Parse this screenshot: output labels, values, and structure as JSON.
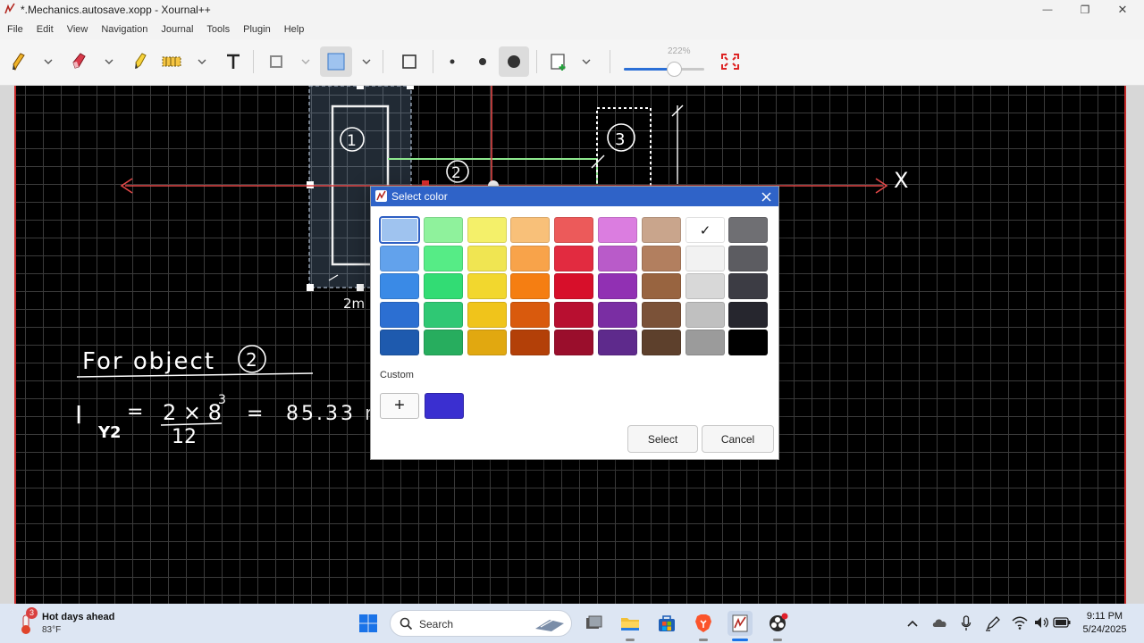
{
  "window": {
    "title": "*.Mechanics.autosave.xopp - Xournal++",
    "minimize_glyph": "—",
    "restore_glyph": "❐",
    "close_glyph": "✕"
  },
  "menu": [
    "File",
    "Edit",
    "View",
    "Navigation",
    "Journal",
    "Tools",
    "Plugin",
    "Help"
  ],
  "toolbar": {
    "zoom_label": "222%",
    "zoom_fraction": 0.62,
    "tools": [
      "pen-icon",
      "eraser-icon",
      "highlighter-icon",
      "select-area-icon",
      "text-icon",
      "shape-icon",
      "fill-color-icon",
      "rectangle-icon",
      "dot-small-icon",
      "dot-medium-icon",
      "dot-large-icon",
      "add-page-icon",
      "fit-screen-icon"
    ]
  },
  "canvas": {
    "handwriting": {
      "label_1": "1",
      "label_2": "2",
      "label_3": "3",
      "axis_x": "X",
      "dimension_text": "2m",
      "heading": "For object",
      "heading_circled": "2",
      "formula_symbol": "I",
      "formula_subscript": "Y2",
      "formula_numerator": "2 × 8",
      "formula_exponent": "3",
      "formula_denominator": "12",
      "formula_equals": "=",
      "formula_result": "85.33 r"
    }
  },
  "dialog": {
    "title": "Select color",
    "custom_label": "Custom",
    "add_glyph": "+",
    "select_label": "Select",
    "cancel_label": "Cancel",
    "check_glyph": "✓",
    "custom_color": "#3a2fd0",
    "palette": [
      [
        "#9fc3ef",
        "#8ff29c",
        "#f4f06a",
        "#f8c079",
        "#ec5a5a",
        "#db7de0",
        "#c9a58c",
        "#ffffff",
        "#6f6f73"
      ],
      [
        "#62a2ec",
        "#56ec86",
        "#f0e552",
        "#f8a34a",
        "#e22b40",
        "#b95bc9",
        "#b27f5f",
        "#f2f2f2",
        "#5c5c61"
      ],
      [
        "#3a8ae6",
        "#32dc74",
        "#f2d72e",
        "#f57e12",
        "#d70f2a",
        "#9130b3",
        "#986440",
        "#d8d8d8",
        "#3c3c44"
      ],
      [
        "#2c6fd2",
        "#2fc874",
        "#f0c41b",
        "#d95a0d",
        "#b80f30",
        "#7a2ea3",
        "#7b5238",
        "#c0c0c0",
        "#26262e"
      ],
      [
        "#1e5aae",
        "#27ad5e",
        "#e1a810",
        "#b34008",
        "#9a0e2c",
        "#5e2a8c",
        "#5d402c",
        "#9b9b9b",
        "#000000"
      ]
    ],
    "selected_index": [
      0,
      0
    ],
    "checked_index": [
      0,
      7
    ]
  },
  "taskbar": {
    "weather_title": "Hot days ahead",
    "weather_temp": "83°F",
    "weather_badge": "3",
    "search_label": "Search",
    "time": "9:11 PM",
    "date": "5/24/2025",
    "apps": [
      "start-icon",
      "search-icon",
      "task-view-icon",
      "file-explorer-icon",
      "store-icon",
      "brave-browser-icon",
      "xournal-icon",
      "obs-icon"
    ],
    "tray": [
      "chevron-up-icon",
      "onedrive-icon",
      "microphone-icon",
      "pen-tray-icon",
      "wifi-icon",
      "volume-icon",
      "battery-icon"
    ]
  }
}
